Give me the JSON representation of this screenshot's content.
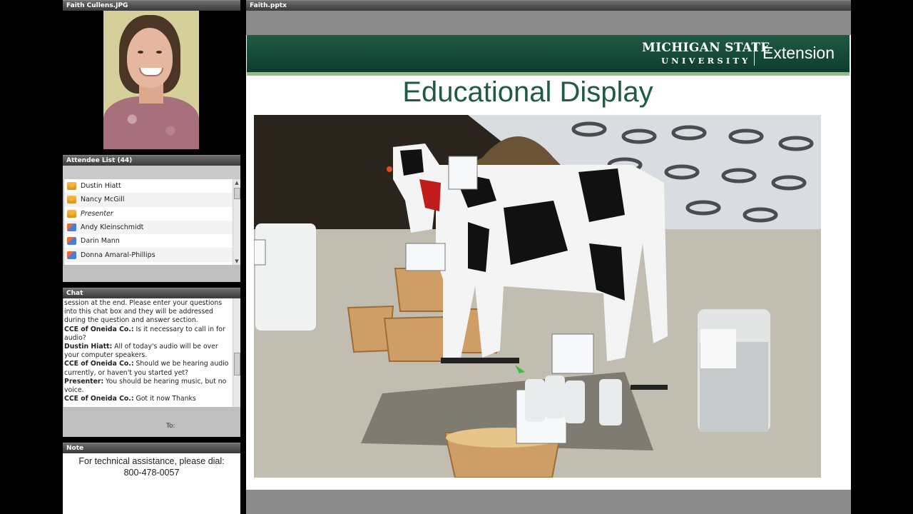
{
  "camera_pod": {
    "title": "Faith Cullens.JPG"
  },
  "share_pod": {
    "title": "Faith.pptx",
    "slide": {
      "logo_line1": "MICHIGAN STATE",
      "logo_line2": "UNIVERSITY",
      "logo_extension": "Extension",
      "title": "Educational Display"
    }
  },
  "attendee_pod": {
    "title": "Attendee List (44)",
    "attendees": [
      {
        "name": "Dustin Hiatt",
        "role": "host"
      },
      {
        "name": "Nancy McGill",
        "role": "host"
      },
      {
        "name": "Presenter",
        "role": "presenter"
      },
      {
        "name": "Andy Kleinschmidt",
        "role": "participant"
      },
      {
        "name": "Darin Mann",
        "role": "participant"
      },
      {
        "name": "Donna Amaral-Phillips",
        "role": "participant"
      }
    ]
  },
  "chat_pod": {
    "title": "Chat",
    "messages": [
      {
        "sender": "",
        "text": "session at the end. Please enter your questions into this chat box and they will be addressed during the question and answer section."
      },
      {
        "sender": "CCE of Oneida Co.:",
        "text": " Is it necessary to call in for audio?"
      },
      {
        "sender": "Dustin Hiatt:",
        "text": " All of today's audio will be over your computer speakers."
      },
      {
        "sender": "CCE of Oneida Co.:",
        "text": " Should we be hearing audio currently, or haven't you started yet?"
      },
      {
        "sender": "Presenter:",
        "text": " You should be hearing music, but no voice."
      },
      {
        "sender": "CCE of Oneida Co.:",
        "text": " Got it now  Thanks"
      }
    ],
    "to_label": "To:"
  },
  "note_pod": {
    "title": "Note",
    "line1": "For technical assistance, please dial:",
    "line2": "800-478-0057"
  }
}
